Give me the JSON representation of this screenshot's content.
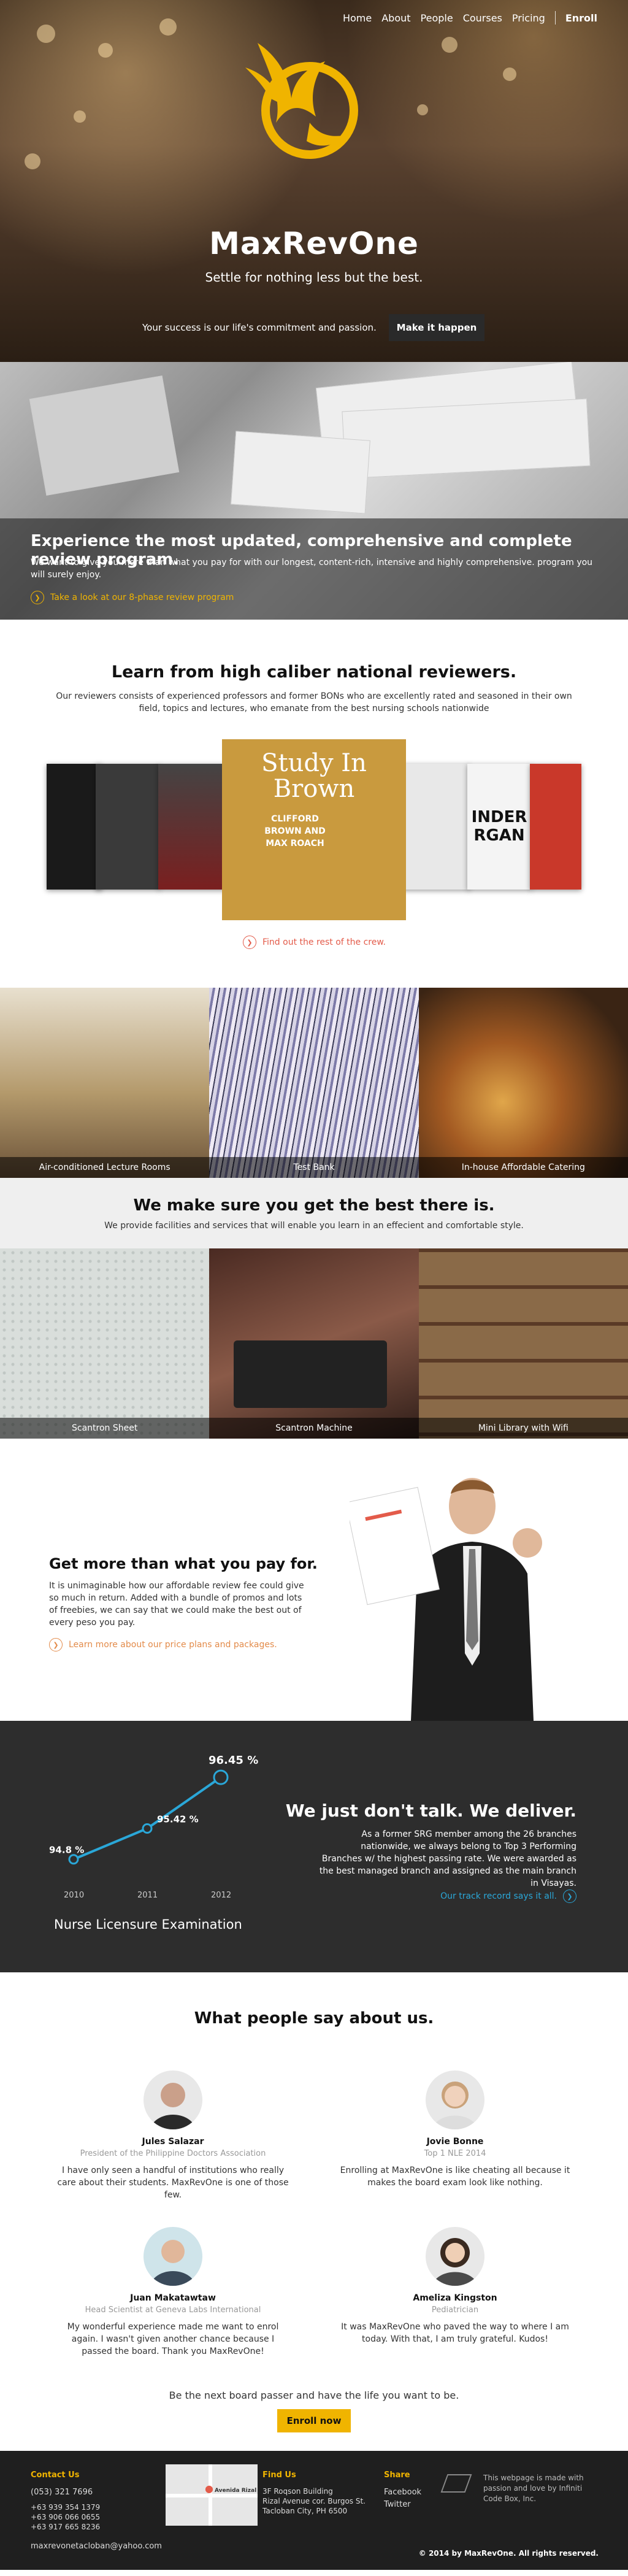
{
  "nav": {
    "items": [
      "Home",
      "About",
      "People",
      "Courses",
      "Pricing"
    ],
    "enroll": "Enroll"
  },
  "hero": {
    "title": "MaxRevOne",
    "tagline": "Settle for nothing less but the best.",
    "commitment": "Your success is our life's commitment and passion.",
    "button": "Make it happen"
  },
  "program": {
    "heading": "Experience the most updated, comprehensive and complete review program.",
    "text": "We want to give you more than what you pay for with our longest, content-rich, intensive and highly comprehensive. program you will surely enjoy.",
    "link": "Take a look at our 8-phase review program"
  },
  "crew": {
    "heading": "Learn from high caliber national reviewers.",
    "text": "Our reviewers consists of experienced professors and former BONs who are excellently rated and seasoned in their own field, topics and lectures, who emanate from the best nursing schools nationwide",
    "album_title": "Study In Brown",
    "album_names": "CLIFFORD BROWN AND MAX ROACH",
    "album_side": "INDER RGAN",
    "link": "Find out the rest of the crew."
  },
  "facilities": [
    "Air-conditioned Lecture Rooms",
    "Test Bank",
    "In-house Affordable Catering"
  ],
  "best": {
    "heading": "We make sure you get the best there is.",
    "text": "We provide facilities and services that will enable you learn in an effecient and comfortable style."
  },
  "services": [
    "Scantron Sheet",
    "Scantron Machine",
    "Mini Library with Wifi"
  ],
  "more": {
    "heading": "Get more than what you pay for.",
    "text": "It is unimaginable how our affordable review fee could give so much in return. Added with a bundle of promos and lots of freebies, we can say that we could make the best out of every peso you pay.",
    "link": "Learn more about our price plans and packages."
  },
  "stats": {
    "heading": "We just don't talk. We deliver.",
    "text": "As a former SRG member among the 26 branches nationwide, we always belong to Top 3 Performing Branches w/ the highest passing rate. We were awarded as the best managed branch and assigned as the main branch in Visayas.",
    "link": "Our track record says it all.",
    "exam": "Nurse Licensure Examination",
    "points": [
      {
        "year": "2010",
        "label": "94.8 %",
        "value": 94.8
      },
      {
        "year": "2011",
        "label": "95.42 %",
        "value": 95.42
      },
      {
        "year": "2012",
        "label": "96.45 %",
        "value": 96.45
      }
    ],
    "line_color": "#2aa7d8"
  },
  "testimonials": {
    "heading": "What people say about us.",
    "people": [
      {
        "name": "Jules Salazar",
        "title": "President of the Philippine Doctors Association",
        "quote": "I have only seen a handful of institutions who really care about their students. MaxRevOne is one of those few."
      },
      {
        "name": "Jovie Bonne",
        "title": "Top 1 NLE 2014",
        "quote": "Enrolling at MaxRevOne is like cheating all because it makes the board exam look like nothing."
      },
      {
        "name": "Juan Makatawtaw",
        "title": "Head Scientist at Geneva Labs International",
        "quote": "My wonderful experience made me want to enrol again. I wasn't given another chance because I passed the board. Thank you MaxRevOne!"
      },
      {
        "name": "Ameliza Kingston",
        "title": "Pediatrician",
        "quote": "It was MaxRevOne who paved the way to where I am today. With that, I am truly grateful. Kudos!"
      }
    ],
    "cta": "Be the next board passer and have the life you want to be.",
    "button": "Enroll now"
  },
  "footer": {
    "contact_heading": "Contact Us",
    "phones": [
      "(053) 321 7696",
      "+63 939 354 1379",
      "+63 906 066 0655",
      "+63 917 665 8236"
    ],
    "email": "maxrevonetacloban@yahoo.com",
    "map_label": "Avenida Rizal",
    "find_heading": "Find Us",
    "address": [
      "3F Roqson Building",
      "Rizal Avenue cor. Burgos St.",
      "Tacloban City, PH 6500"
    ],
    "share_heading": "Share",
    "share": [
      "Facebook",
      "Twitter"
    ],
    "credit": "This webpage is made with passion and love by Infiniti Code Box, Inc.",
    "copyright": "© 2014 by MaxRevOne. All rights reserved."
  },
  "colors": {
    "accent": "#f0b400",
    "dark": "#2d2d2d",
    "link_red": "#e35b4a",
    "link_blue": "#2aa7d8"
  }
}
